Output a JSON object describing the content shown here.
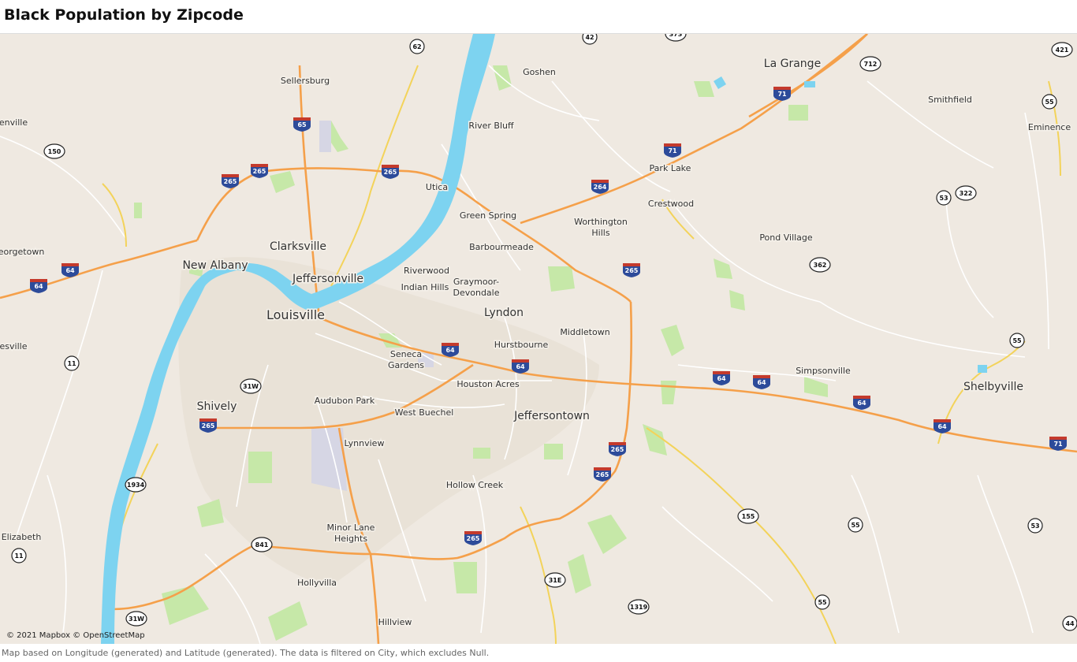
{
  "title": "Black Population by Zipcode",
  "map": {
    "attribution": "© 2021 Mapbox © OpenStreetMap",
    "places": [
      {
        "name": "Louisville",
        "size": "lg"
      },
      {
        "name": "Clarksville",
        "size": "md"
      },
      {
        "name": "Jeffersonville",
        "size": "md"
      },
      {
        "name": "New Albany",
        "size": "md"
      },
      {
        "name": "Shively",
        "size": "md"
      },
      {
        "name": "Lyndon",
        "size": "md"
      },
      {
        "name": "Jeffersontown",
        "size": "md"
      },
      {
        "name": "La Grange",
        "size": "md"
      },
      {
        "name": "Shelbyville",
        "size": "md"
      },
      {
        "name": "Sellersburg",
        "size": "sm"
      },
      {
        "name": "Goshen",
        "size": "sm"
      },
      {
        "name": "River Bluff",
        "size": "sm"
      },
      {
        "name": "Utica",
        "size": "sm"
      },
      {
        "name": "Green Spring",
        "size": "sm"
      },
      {
        "name": "Worthington",
        "size": "sm"
      },
      {
        "name": "Hills",
        "size": "sm"
      },
      {
        "name": "Barbourmeade",
        "size": "sm"
      },
      {
        "name": "Riverwood",
        "size": "sm"
      },
      {
        "name": "Indian Hills",
        "size": "sm"
      },
      {
        "name": "Graymoor-",
        "size": "sm"
      },
      {
        "name": "Devondale",
        "size": "sm"
      },
      {
        "name": "Middletown",
        "size": "sm"
      },
      {
        "name": "Hurstbourne",
        "size": "sm"
      },
      {
        "name": "Seneca",
        "size": "sm"
      },
      {
        "name": "Gardens",
        "size": "sm"
      },
      {
        "name": "Houston Acres",
        "size": "sm"
      },
      {
        "name": "Audubon Park",
        "size": "sm"
      },
      {
        "name": "West Buechel",
        "size": "sm"
      },
      {
        "name": "Lynnview",
        "size": "sm"
      },
      {
        "name": "Hollow Creek",
        "size": "sm"
      },
      {
        "name": "Minor Lane",
        "size": "sm"
      },
      {
        "name": "Heights",
        "size": "sm"
      },
      {
        "name": "Hollyvilla",
        "size": "sm"
      },
      {
        "name": "Hillview",
        "size": "sm"
      },
      {
        "name": "Park Lake",
        "size": "sm"
      },
      {
        "name": "Crestwood",
        "size": "sm"
      },
      {
        "name": "Pond Village",
        "size": "sm"
      },
      {
        "name": "Smithfield",
        "size": "sm"
      },
      {
        "name": "Eminence",
        "size": "sm"
      },
      {
        "name": "Simpsonville",
        "size": "sm"
      },
      {
        "name": "Elizabeth",
        "size": "sm"
      },
      {
        "name": "enville",
        "size": "sm"
      },
      {
        "name": "eorgetown",
        "size": "sm"
      },
      {
        "name": "esville",
        "size": "sm"
      }
    ],
    "interstates": [
      "265",
      "265",
      "265",
      "265",
      "265",
      "265",
      "265",
      "265",
      "65",
      "64",
      "64",
      "64",
      "64",
      "64",
      "64",
      "64",
      "64",
      "71",
      "71",
      "71",
      "264"
    ],
    "routes": [
      "62",
      "42",
      "150",
      "712",
      "421",
      "55",
      "53",
      "322",
      "362",
      "55",
      "11",
      "31W",
      "1934",
      "841",
      "11",
      "155",
      "55",
      "53",
      "31E",
      "1319",
      "55",
      "31W",
      "44",
      "373"
    ]
  },
  "footnote": "Map based on Longitude (generated) and Latitude (generated). The data is filtered on City, which excludes Null.",
  "colors": {
    "land": "#efe9e1",
    "water": "#7dd3f0",
    "park": "#c6e8a8",
    "interstate": "#f5a04a",
    "highway": "#f3d35a",
    "road": "#ffffff",
    "urban": "#e6dfd2"
  }
}
